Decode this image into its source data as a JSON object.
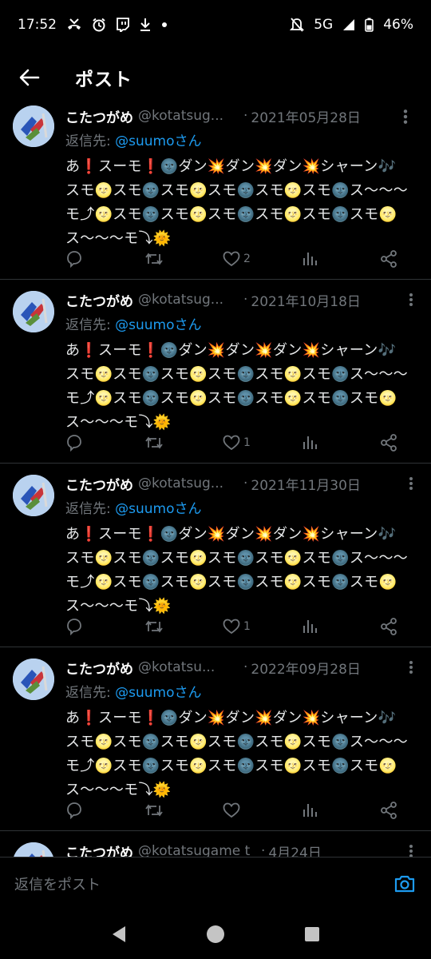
{
  "status_bar": {
    "time": "17:52",
    "network": "5G",
    "battery": "46%",
    "left_icons": [
      "missed-call-icon",
      "alarm-icon",
      "twitch-icon",
      "download-icon",
      "dot-icon"
    ],
    "right_icons": [
      "bell-off-icon",
      "signal-icon",
      "battery-icon"
    ]
  },
  "top_bar": {
    "title": "ポスト",
    "back_icon": "arrow-left-icon"
  },
  "tweet_text": "あ❗スーモ❗🌚ダン💥ダン💥ダン💥シャーン🎶スモ🌝スモ🌚スモ🌝スモ🌚スモ🌝スモ🌚ス〜〜〜モ⤴🌝スモ🌚スモ🌝スモ🌚スモ🌝スモ🌚スモ🌝ス〜〜〜モ⤵🌞",
  "tweets": [
    {
      "name": "こたつがめ",
      "handle": "@kotatsug...",
      "sep": "·",
      "date": "2021年05月28日",
      "reply_prefix": "返信先: ",
      "reply_user": "@suumoさん",
      "likes": "2"
    },
    {
      "name": "こたつがめ",
      "handle": "@kotatsug...",
      "sep": "·",
      "date": "2021年10月18日",
      "reply_prefix": "返信先: ",
      "reply_user": "@suumoさん",
      "likes": "1"
    },
    {
      "name": "こたつがめ",
      "handle": "@kotatsug...",
      "sep": "·",
      "date": "2021年11月30日",
      "reply_prefix": "返信先: ",
      "reply_user": "@suumoさん",
      "likes": "1"
    },
    {
      "name": "こたつがめ",
      "handle": "@kotatsu...",
      "sep": "·",
      "date": "2022年09月28日",
      "reply_prefix": "返信先: ",
      "reply_user": "@suumoさん",
      "likes": ""
    },
    {
      "name": "こたつがめ",
      "handle": "@kotatsugame t",
      "sep": "·",
      "date": "4月24日",
      "reply_prefix": "",
      "reply_user": "",
      "likes": ""
    }
  ],
  "reply_bar": {
    "placeholder": "返信をポスト",
    "camera_icon": "camera-icon"
  },
  "nav_bar": {
    "icons": [
      "back-triangle-icon",
      "home-circle-icon",
      "recents-square-icon"
    ]
  },
  "colors": {
    "background": "#000000",
    "text": "#e7e9ea",
    "muted": "#71767b",
    "link": "#1d9bf0",
    "divider": "#2f3336"
  }
}
